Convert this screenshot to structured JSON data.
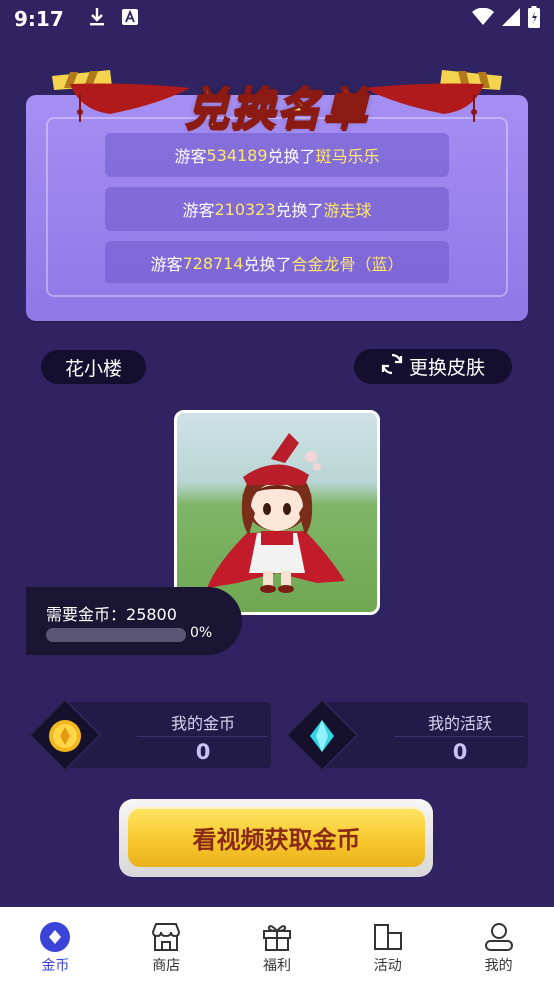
{
  "status_bar": {
    "time": "9:17"
  },
  "exchange_list": {
    "title": "兑换名单",
    "records": [
      {
        "prefix": "游客 ",
        "user_id": "534189",
        "action": " 兑换了 ",
        "item": "斑马乐乐"
      },
      {
        "prefix": "游客 ",
        "user_id": "210323",
        "action": " 兑换了 ",
        "item": "游走球"
      },
      {
        "prefix": "游客 ",
        "user_id": "728714",
        "action": " 兑换了 ",
        "item": "合金龙骨（蓝）"
      }
    ]
  },
  "skin": {
    "name": "花小楼",
    "change_label": "更换皮肤"
  },
  "need": {
    "label": "需要金币：",
    "amount": "25800",
    "progress_percent": 0,
    "progress_text": "0%"
  },
  "stats": {
    "coins": {
      "label": "我的金币",
      "value": "0"
    },
    "activity": {
      "label": "我的活跃",
      "value": "0"
    }
  },
  "cta": {
    "label": "看视频获取金币"
  },
  "nav": {
    "items": [
      {
        "label": "金币",
        "icon": "coin-diamond-icon",
        "active": true
      },
      {
        "label": "商店",
        "icon": "shop-icon",
        "active": false
      },
      {
        "label": "福利",
        "icon": "gift-icon",
        "active": false
      },
      {
        "label": "活动",
        "icon": "activity-icon",
        "active": false
      },
      {
        "label": "我的",
        "icon": "profile-icon",
        "active": false
      }
    ]
  },
  "colors": {
    "background": "#2f2461",
    "card": "#9a85ee",
    "accent_yellow": "#ffe76a",
    "cta": "#f6c62a",
    "nav_active": "#3a44d8"
  }
}
